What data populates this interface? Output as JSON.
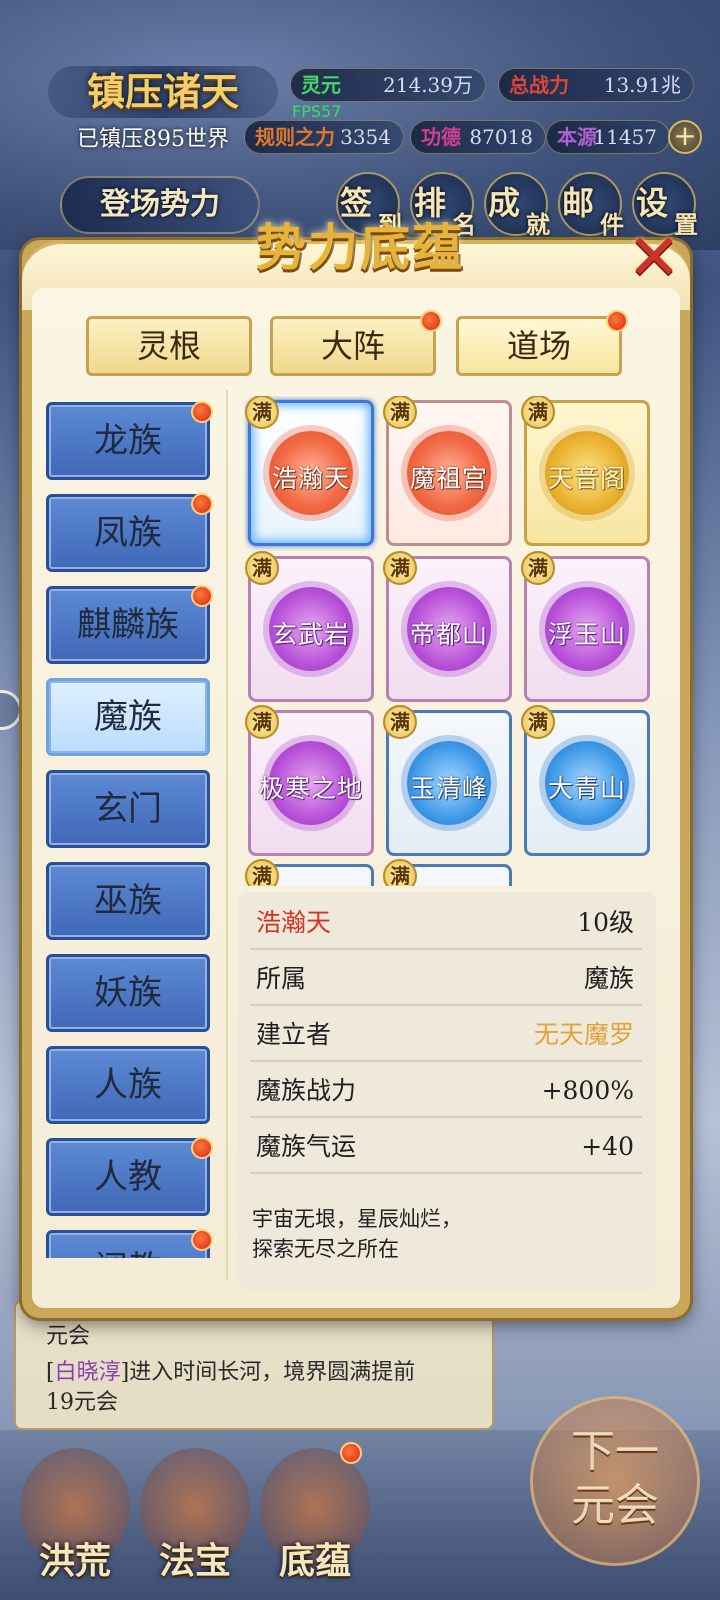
{
  "hud": {
    "title": "镇压诸天",
    "subtitle": "已镇压895世界",
    "fps": "FPS57",
    "stats": [
      {
        "label": "灵元",
        "value": "214.39万",
        "color": "#4bd36b"
      },
      {
        "label": "总战力",
        "value": "13.91兆",
        "color": "#e0453a"
      },
      {
        "label": "规则之力",
        "value": "3354",
        "color": "#e07a2a"
      },
      {
        "label": "功德",
        "value": "87018",
        "color": "#d04090"
      },
      {
        "label": "本源",
        "value": "11457",
        "color": "#b060d0"
      }
    ],
    "plus": "+",
    "enter_button": "登场势力",
    "icons": [
      {
        "a": "签",
        "b": "到"
      },
      {
        "a": "排",
        "b": "名"
      },
      {
        "a": "成",
        "b": "就"
      },
      {
        "a": "邮",
        "b": "件"
      },
      {
        "a": "设",
        "b": "置"
      }
    ]
  },
  "modal": {
    "title": "势力底蕴",
    "close": "✕",
    "tabs": [
      {
        "label": "灵根",
        "dot": false
      },
      {
        "label": "大阵",
        "dot": true
      },
      {
        "label": "道场",
        "dot": true
      }
    ],
    "tribes": [
      {
        "label": "龙族",
        "dot": true
      },
      {
        "label": "凤族",
        "dot": true
      },
      {
        "label": "麒麟族",
        "dot": true
      },
      {
        "label": "魔族",
        "dot": false,
        "active": true
      },
      {
        "label": "玄门",
        "dot": false
      },
      {
        "label": "巫族",
        "dot": false
      },
      {
        "label": "妖族",
        "dot": false
      },
      {
        "label": "人族",
        "dot": false
      },
      {
        "label": "人教",
        "dot": true
      },
      {
        "label": "阐教",
        "dot": true
      }
    ],
    "full_badge": "满",
    "cards": [
      {
        "name": "浩瀚天",
        "style": "sel"
      },
      {
        "name": "魔祖宫",
        "style": "red"
      },
      {
        "name": "天音阁",
        "style": "gold"
      },
      {
        "name": "玄武岩",
        "style": "purple"
      },
      {
        "name": "帝都山",
        "style": "purple"
      },
      {
        "name": "浮玉山",
        "style": "purple"
      },
      {
        "name": "极寒之地",
        "style": "purple"
      },
      {
        "name": "玉清峰",
        "style": "blue"
      },
      {
        "name": "大青山",
        "style": "blue"
      },
      {
        "name": "",
        "style": "blue"
      },
      {
        "name": "",
        "style": "blue"
      }
    ],
    "detail": {
      "name": "浩瀚天",
      "level": "10级",
      "rows": [
        {
          "k": "所属",
          "v": "魔族"
        },
        {
          "k": "建立者",
          "v": "无天魔罗"
        },
        {
          "k": "魔族战力",
          "v": "+800%"
        },
        {
          "k": "魔族气运",
          "v": "+40"
        }
      ],
      "desc": "宇宙无垠，星辰灿烂，\n探索无尽之所在"
    }
  },
  "log": {
    "line1": "元会",
    "prefix": "[",
    "name": "白晓淳",
    "suffix": "]进入时间长河，境界圆满提前",
    "line3": "19元会"
  },
  "bottom_nav": [
    {
      "label": "洪荒"
    },
    {
      "label": "法宝"
    },
    {
      "label": "底蕴"
    }
  ],
  "next_button": {
    "line1": "下一",
    "line2": "元会"
  }
}
